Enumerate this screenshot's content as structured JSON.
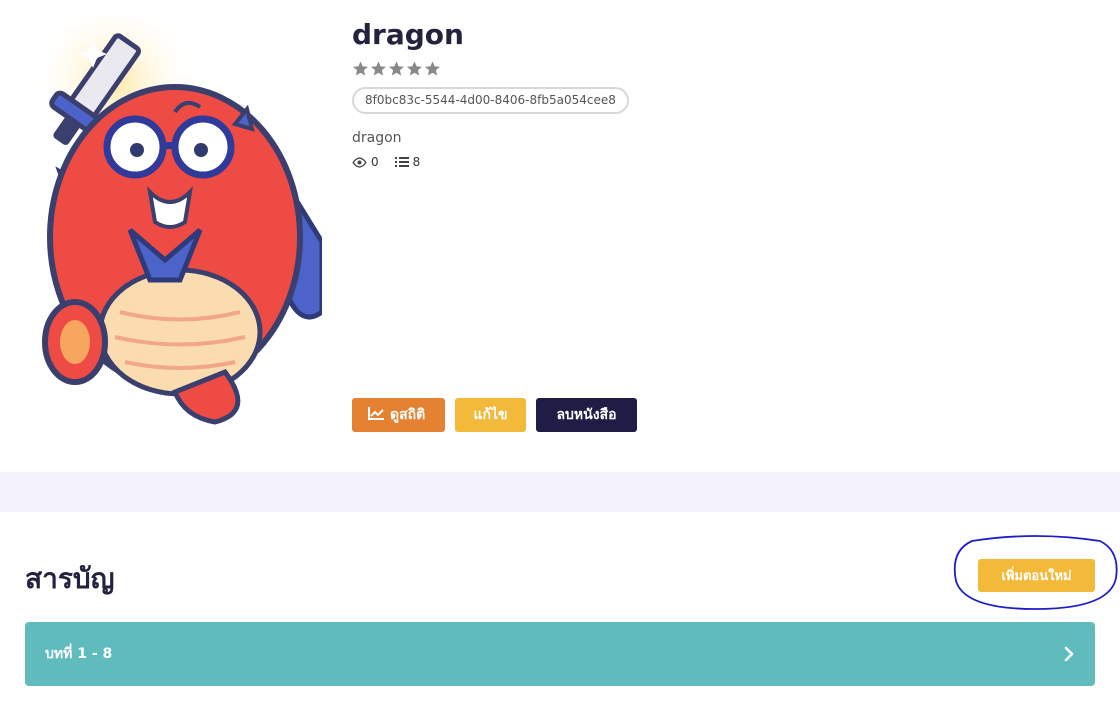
{
  "book": {
    "title": "dragon",
    "rating": 0,
    "rating_max": 5,
    "uuid": "8f0bc83c-5544-4d00-8406-8fb5a054cee8",
    "description": "dragon",
    "views": "0",
    "chapters": "8"
  },
  "icons": {
    "star": "star-icon",
    "eye": "eye-icon",
    "list": "list-icon",
    "chart": "line-chart-icon",
    "chevron": "chevron-right-icon"
  },
  "actions": {
    "stats_label": "ดูสถิติ",
    "edit_label": "แก้ไข",
    "delete_label": "ลบหนังสือ"
  },
  "toc": {
    "title": "สารบัญ",
    "add_episode_label": "เพิ่มตอนใหม่",
    "chapter_range_label": "บทที่ 1 - 8"
  },
  "colors": {
    "accent_orange": "#e48232",
    "accent_yellow": "#f2b93b",
    "navy": "#1f1d45",
    "teal": "#60bbbc",
    "band": "#f3f2fc",
    "annotation": "#1e1ec8"
  }
}
